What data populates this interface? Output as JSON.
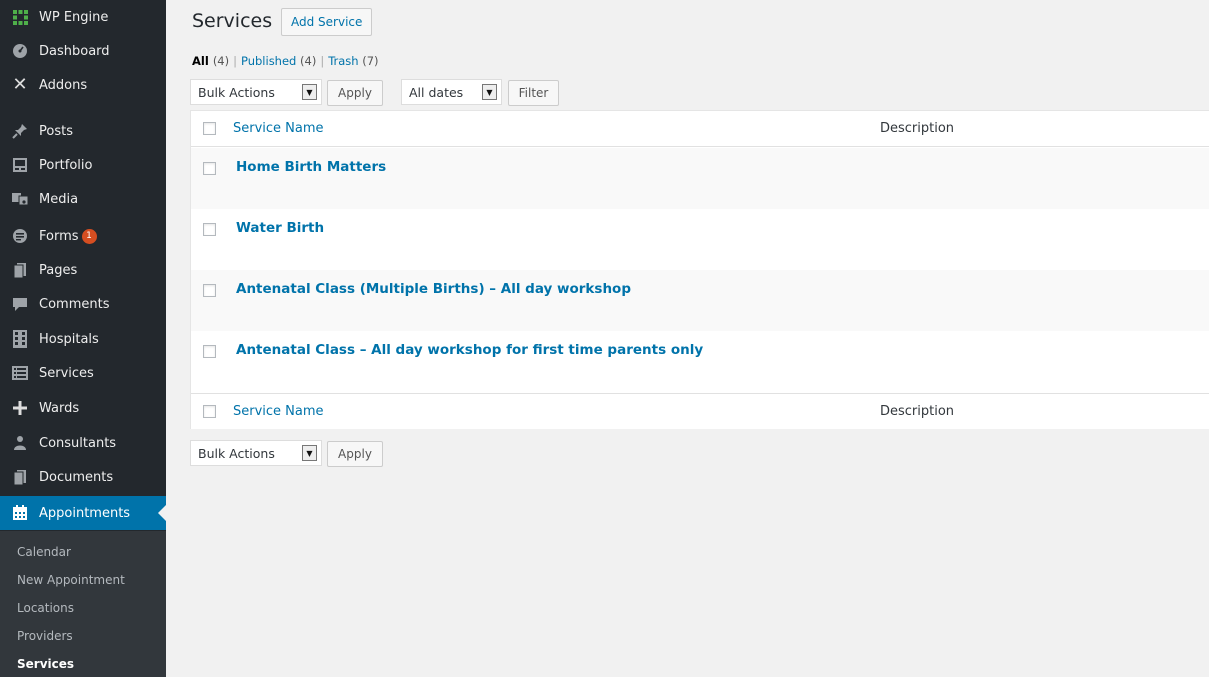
{
  "sidebar": {
    "items": [
      {
        "label": "WP Engine",
        "icon": "wp-engine-icon"
      },
      {
        "label": "Dashboard",
        "icon": "dashboard-icon"
      },
      {
        "label": "Addons",
        "icon": "addons-x-icon"
      },
      {
        "label": "Posts",
        "icon": "pin-icon"
      },
      {
        "label": "Portfolio",
        "icon": "portfolio-icon"
      },
      {
        "label": "Media",
        "icon": "media-icon"
      },
      {
        "label": "Forms",
        "icon": "forms-icon",
        "badge": "1"
      },
      {
        "label": "Pages",
        "icon": "pages-icon"
      },
      {
        "label": "Comments",
        "icon": "comments-icon"
      },
      {
        "label": "Hospitals",
        "icon": "building-icon"
      },
      {
        "label": "Services",
        "icon": "list-icon"
      },
      {
        "label": "Wards",
        "icon": "plus-icon"
      },
      {
        "label": "Consultants",
        "icon": "users-icon"
      },
      {
        "label": "Documents",
        "icon": "documents-icon"
      },
      {
        "label": "Appointments",
        "icon": "calendar-icon"
      }
    ],
    "submenu": [
      "Calendar",
      "New Appointment",
      "Locations",
      "Providers",
      "Services"
    ],
    "colors": {
      "background": "#23282d",
      "active": "#0073aa",
      "badge": "#d54e21"
    }
  },
  "header": {
    "title": "Services",
    "add_button": "Add Service"
  },
  "views": {
    "all_label": "All",
    "all_count": "(4)",
    "published_label": "Published",
    "published_count": "(4)",
    "trash_label": "Trash",
    "trash_count": "(7)",
    "separator": "|"
  },
  "toolbar_top": {
    "bulk_actions": "Bulk Actions",
    "apply": "Apply",
    "dates": "All dates",
    "filter": "Filter"
  },
  "table": {
    "columns": [
      "Service Name",
      "Description"
    ],
    "rows": [
      {
        "title": "Home Birth Matters",
        "description": ""
      },
      {
        "title": "Water Birth",
        "description": ""
      },
      {
        "title": "Antenatal Class (Multiple Births) – All day workshop",
        "description": ""
      },
      {
        "title": "Antenatal Class – All day workshop for first time parents only",
        "description": ""
      }
    ]
  },
  "toolbar_bottom": {
    "bulk_actions": "Bulk Actions",
    "apply": "Apply"
  }
}
